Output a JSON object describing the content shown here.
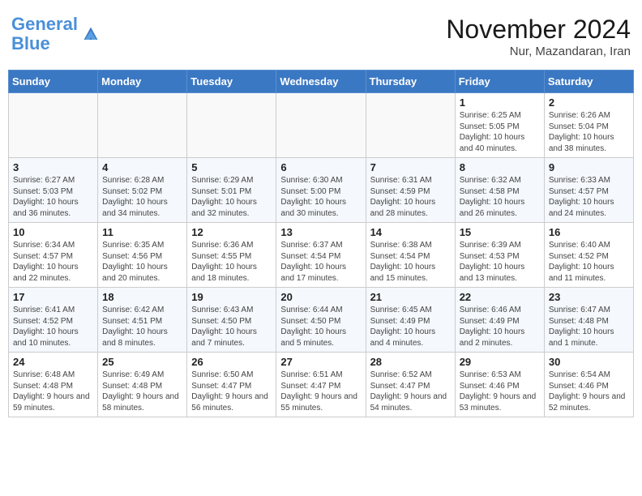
{
  "header": {
    "logo_line1": "General",
    "logo_line2": "Blue",
    "month_title": "November 2024",
    "location": "Nur, Mazandaran, Iran"
  },
  "weekdays": [
    "Sunday",
    "Monday",
    "Tuesday",
    "Wednesday",
    "Thursday",
    "Friday",
    "Saturday"
  ],
  "weeks": [
    [
      {
        "day": "",
        "info": ""
      },
      {
        "day": "",
        "info": ""
      },
      {
        "day": "",
        "info": ""
      },
      {
        "day": "",
        "info": ""
      },
      {
        "day": "",
        "info": ""
      },
      {
        "day": "1",
        "info": "Sunrise: 6:25 AM\nSunset: 5:05 PM\nDaylight: 10 hours and 40 minutes."
      },
      {
        "day": "2",
        "info": "Sunrise: 6:26 AM\nSunset: 5:04 PM\nDaylight: 10 hours and 38 minutes."
      }
    ],
    [
      {
        "day": "3",
        "info": "Sunrise: 6:27 AM\nSunset: 5:03 PM\nDaylight: 10 hours and 36 minutes."
      },
      {
        "day": "4",
        "info": "Sunrise: 6:28 AM\nSunset: 5:02 PM\nDaylight: 10 hours and 34 minutes."
      },
      {
        "day": "5",
        "info": "Sunrise: 6:29 AM\nSunset: 5:01 PM\nDaylight: 10 hours and 32 minutes."
      },
      {
        "day": "6",
        "info": "Sunrise: 6:30 AM\nSunset: 5:00 PM\nDaylight: 10 hours and 30 minutes."
      },
      {
        "day": "7",
        "info": "Sunrise: 6:31 AM\nSunset: 4:59 PM\nDaylight: 10 hours and 28 minutes."
      },
      {
        "day": "8",
        "info": "Sunrise: 6:32 AM\nSunset: 4:58 PM\nDaylight: 10 hours and 26 minutes."
      },
      {
        "day": "9",
        "info": "Sunrise: 6:33 AM\nSunset: 4:57 PM\nDaylight: 10 hours and 24 minutes."
      }
    ],
    [
      {
        "day": "10",
        "info": "Sunrise: 6:34 AM\nSunset: 4:57 PM\nDaylight: 10 hours and 22 minutes."
      },
      {
        "day": "11",
        "info": "Sunrise: 6:35 AM\nSunset: 4:56 PM\nDaylight: 10 hours and 20 minutes."
      },
      {
        "day": "12",
        "info": "Sunrise: 6:36 AM\nSunset: 4:55 PM\nDaylight: 10 hours and 18 minutes."
      },
      {
        "day": "13",
        "info": "Sunrise: 6:37 AM\nSunset: 4:54 PM\nDaylight: 10 hours and 17 minutes."
      },
      {
        "day": "14",
        "info": "Sunrise: 6:38 AM\nSunset: 4:54 PM\nDaylight: 10 hours and 15 minutes."
      },
      {
        "day": "15",
        "info": "Sunrise: 6:39 AM\nSunset: 4:53 PM\nDaylight: 10 hours and 13 minutes."
      },
      {
        "day": "16",
        "info": "Sunrise: 6:40 AM\nSunset: 4:52 PM\nDaylight: 10 hours and 11 minutes."
      }
    ],
    [
      {
        "day": "17",
        "info": "Sunrise: 6:41 AM\nSunset: 4:52 PM\nDaylight: 10 hours and 10 minutes."
      },
      {
        "day": "18",
        "info": "Sunrise: 6:42 AM\nSunset: 4:51 PM\nDaylight: 10 hours and 8 minutes."
      },
      {
        "day": "19",
        "info": "Sunrise: 6:43 AM\nSunset: 4:50 PM\nDaylight: 10 hours and 7 minutes."
      },
      {
        "day": "20",
        "info": "Sunrise: 6:44 AM\nSunset: 4:50 PM\nDaylight: 10 hours and 5 minutes."
      },
      {
        "day": "21",
        "info": "Sunrise: 6:45 AM\nSunset: 4:49 PM\nDaylight: 10 hours and 4 minutes."
      },
      {
        "day": "22",
        "info": "Sunrise: 6:46 AM\nSunset: 4:49 PM\nDaylight: 10 hours and 2 minutes."
      },
      {
        "day": "23",
        "info": "Sunrise: 6:47 AM\nSunset: 4:48 PM\nDaylight: 10 hours and 1 minute."
      }
    ],
    [
      {
        "day": "24",
        "info": "Sunrise: 6:48 AM\nSunset: 4:48 PM\nDaylight: 9 hours and 59 minutes."
      },
      {
        "day": "25",
        "info": "Sunrise: 6:49 AM\nSunset: 4:48 PM\nDaylight: 9 hours and 58 minutes."
      },
      {
        "day": "26",
        "info": "Sunrise: 6:50 AM\nSunset: 4:47 PM\nDaylight: 9 hours and 56 minutes."
      },
      {
        "day": "27",
        "info": "Sunrise: 6:51 AM\nSunset: 4:47 PM\nDaylight: 9 hours and 55 minutes."
      },
      {
        "day": "28",
        "info": "Sunrise: 6:52 AM\nSunset: 4:47 PM\nDaylight: 9 hours and 54 minutes."
      },
      {
        "day": "29",
        "info": "Sunrise: 6:53 AM\nSunset: 4:46 PM\nDaylight: 9 hours and 53 minutes."
      },
      {
        "day": "30",
        "info": "Sunrise: 6:54 AM\nSunset: 4:46 PM\nDaylight: 9 hours and 52 minutes."
      }
    ]
  ]
}
